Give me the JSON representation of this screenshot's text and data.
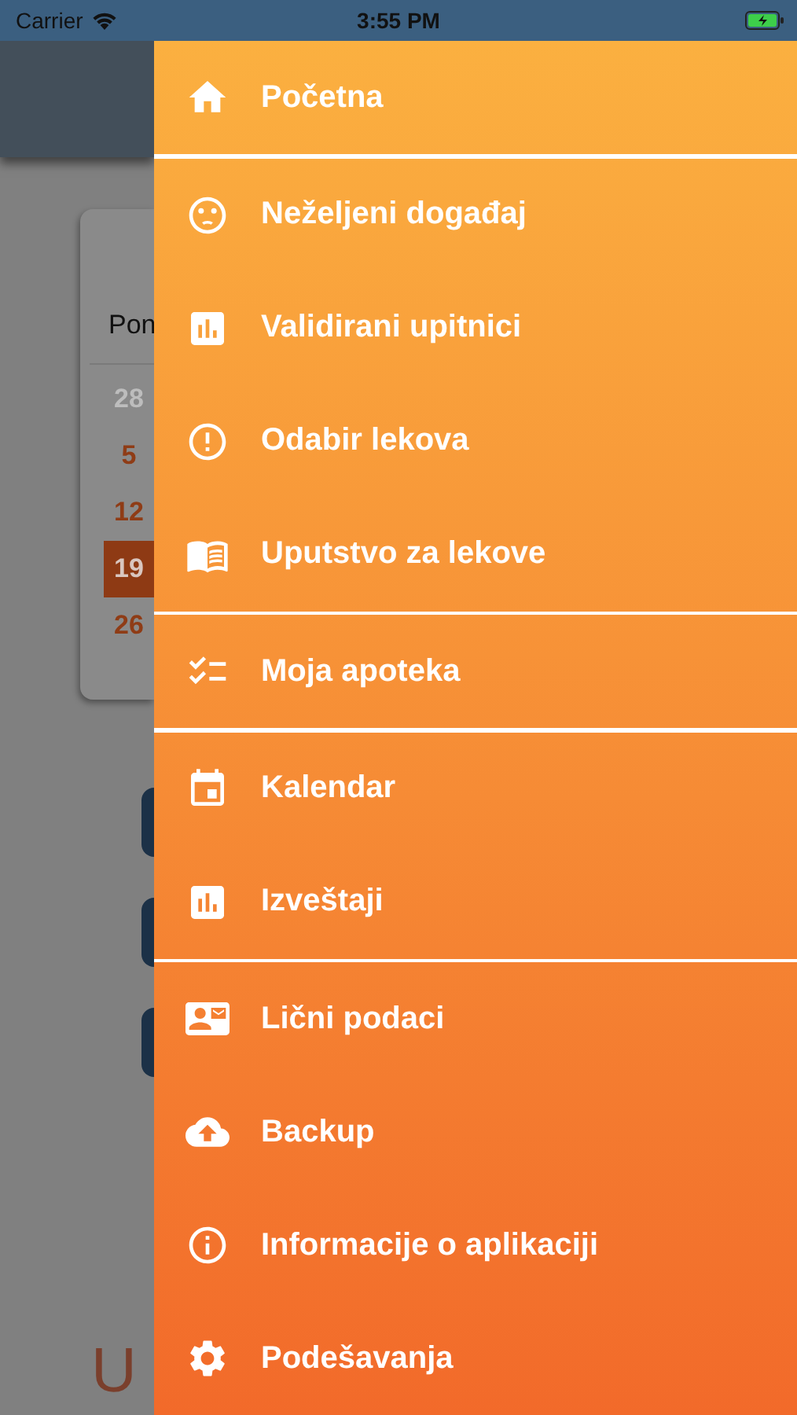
{
  "status_bar": {
    "carrier": "Carrier",
    "time": "3:55 PM"
  },
  "background": {
    "calendar": {
      "weekday": "Pon",
      "days": [
        {
          "label": "28",
          "muted": true,
          "selected": false
        },
        {
          "label": "5",
          "muted": false,
          "selected": false
        },
        {
          "label": "12",
          "muted": false,
          "selected": false
        },
        {
          "label": "19",
          "muted": false,
          "selected": true
        },
        {
          "label": "26",
          "muted": false,
          "selected": false
        }
      ]
    },
    "footer_letter": "U"
  },
  "drawer": {
    "groups": [
      [
        {
          "label": "Početna"
        }
      ],
      [
        {
          "label": "Neželjeni događaj"
        },
        {
          "label": "Validirani upitnici"
        },
        {
          "label": "Odabir lekova"
        },
        {
          "label": "Uputstvo za lekove"
        }
      ],
      [
        {
          "label": "Moja apoteka"
        }
      ],
      [
        {
          "label": "Kalendar"
        },
        {
          "label": "Izveštaji"
        }
      ],
      [
        {
          "label": "Lični podaci"
        },
        {
          "label": "Backup"
        },
        {
          "label": "Informacije o aplikaciji"
        },
        {
          "label": "Podešavanja"
        }
      ]
    ]
  }
}
